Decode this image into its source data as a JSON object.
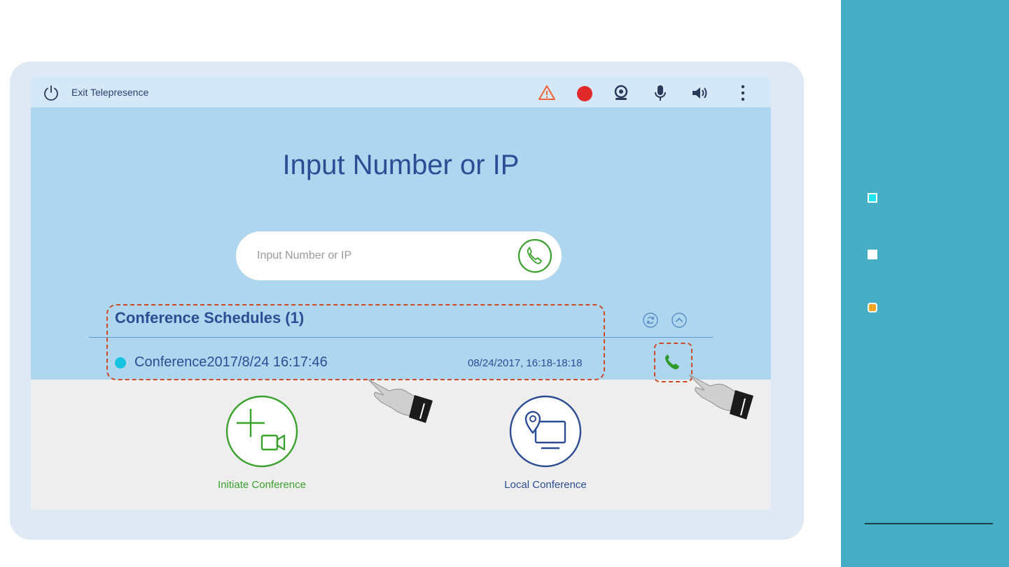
{
  "topbar": {
    "exit_label": "Exit Telepresence",
    "icons": [
      "power-icon",
      "warning-icon",
      "record-icon",
      "camera-icon",
      "microphone-icon",
      "speaker-icon",
      "more-icon"
    ]
  },
  "main": {
    "title": "Input Number or IP",
    "search": {
      "placeholder": "Input Number or IP",
      "value": ""
    }
  },
  "schedules": {
    "title": "Conference Schedules (1)",
    "items": [
      {
        "name": "Conference2017/8/24 16:17:46",
        "time": "08/24/2017, 16:18-18:18",
        "status_color": "#14c3de"
      }
    ]
  },
  "actions": {
    "initiate_label": "Initiate Conference",
    "local_label": "Local Conference"
  },
  "colors": {
    "accent_blue": "#2c4d94",
    "accent_green": "#3aa12e",
    "highlight": "#cc4a24",
    "panel": "#45aec4"
  }
}
